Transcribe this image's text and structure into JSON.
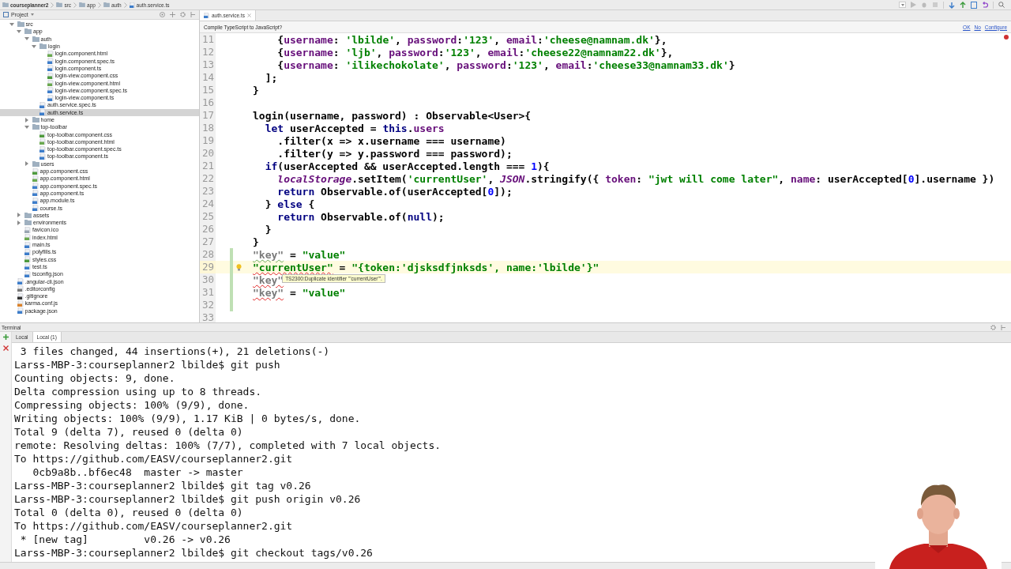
{
  "breadcrumb": [
    {
      "label": "courseplanner2",
      "kind": "project"
    },
    {
      "label": "src",
      "kind": "folder"
    },
    {
      "label": "app",
      "kind": "folder"
    },
    {
      "label": "auth",
      "kind": "folder"
    },
    {
      "label": "auth.service.ts",
      "kind": "file"
    }
  ],
  "project_panel": {
    "title": "Project",
    "tree": [
      {
        "label": "src",
        "kind": "folder",
        "expanded": true,
        "selected": false,
        "children": [
          {
            "label": "app",
            "kind": "folder",
            "expanded": true,
            "selected": false,
            "children": [
              {
                "label": "auth",
                "kind": "folder",
                "expanded": true,
                "selected": false,
                "children": [
                  {
                    "label": "login",
                    "kind": "folder",
                    "expanded": true,
                    "selected": false,
                    "children": [
                      {
                        "label": "login.component.html",
                        "kind": "html",
                        "selected": false
                      },
                      {
                        "label": "login.component.spec.ts",
                        "kind": "ts",
                        "selected": false
                      },
                      {
                        "label": "login.component.ts",
                        "kind": "ts",
                        "selected": false
                      },
                      {
                        "label": "login-view.component.css",
                        "kind": "css",
                        "selected": false
                      },
                      {
                        "label": "login-view.component.html",
                        "kind": "html",
                        "selected": false
                      },
                      {
                        "label": "login-view.component.spec.ts",
                        "kind": "ts",
                        "selected": false
                      },
                      {
                        "label": "login-view.component.ts",
                        "kind": "ts",
                        "selected": false
                      }
                    ]
                  },
                  {
                    "label": "auth.service.spec.ts",
                    "kind": "ts",
                    "selected": false
                  },
                  {
                    "label": "auth.service.ts",
                    "kind": "ts",
                    "selected": true
                  }
                ]
              },
              {
                "label": "home",
                "kind": "folder",
                "expanded": false,
                "selected": false
              },
              {
                "label": "top-toolbar",
                "kind": "folder",
                "expanded": true,
                "selected": false,
                "children": [
                  {
                    "label": "top-toolbar.component.css",
                    "kind": "css",
                    "selected": false
                  },
                  {
                    "label": "top-toolbar.component.html",
                    "kind": "html",
                    "selected": false
                  },
                  {
                    "label": "top-toolbar.component.spec.ts",
                    "kind": "ts",
                    "selected": false
                  },
                  {
                    "label": "top-toolbar.component.ts",
                    "kind": "ts",
                    "selected": false
                  }
                ]
              },
              {
                "label": "users",
                "kind": "folder",
                "expanded": false,
                "selected": false
              },
              {
                "label": "app.component.css",
                "kind": "css",
                "selected": false
              },
              {
                "label": "app.component.html",
                "kind": "html",
                "selected": false
              },
              {
                "label": "app.component.spec.ts",
                "kind": "ts",
                "selected": false
              },
              {
                "label": "app.component.ts",
                "kind": "ts",
                "selected": false
              },
              {
                "label": "app.module.ts",
                "kind": "ts",
                "selected": false
              },
              {
                "label": "course.ts",
                "kind": "ts",
                "selected": false
              }
            ]
          },
          {
            "label": "assets",
            "kind": "folder",
            "expanded": false,
            "selected": false
          },
          {
            "label": "environments",
            "kind": "folder",
            "expanded": false,
            "selected": false
          },
          {
            "label": "favicon.ico",
            "kind": "ico",
            "selected": false
          },
          {
            "label": "index.html",
            "kind": "html",
            "selected": false
          },
          {
            "label": "main.ts",
            "kind": "ts",
            "selected": false
          },
          {
            "label": "polyfills.ts",
            "kind": "ts",
            "selected": false
          },
          {
            "label": "styles.css",
            "kind": "css",
            "selected": false
          },
          {
            "label": "test.ts",
            "kind": "ts",
            "selected": false
          },
          {
            "label": "tsconfig.json",
            "kind": "json",
            "selected": false
          }
        ]
      },
      {
        "label": ".angular-cli.json",
        "kind": "json",
        "selected": false
      },
      {
        "label": ".editorconfig",
        "kind": "config",
        "selected": false
      },
      {
        "label": ".gitignore",
        "kind": "git",
        "selected": false
      },
      {
        "label": "karma.conf.js",
        "kind": "js",
        "selected": false
      },
      {
        "label": "package.json",
        "kind": "json",
        "selected": false
      }
    ]
  },
  "editor": {
    "tabs": [
      {
        "label": "auth.service.ts",
        "selected": true
      }
    ],
    "notification": {
      "text": "Compile TypeScript to JavaScript?",
      "actions": [
        "OK",
        "No",
        "Configure"
      ]
    },
    "lines": [
      {
        "number": "11",
        "current": false,
        "changed": false,
        "bulb": false,
        "tokens": [
          {
            "text": "    {",
            "kind": "plain"
          },
          {
            "text": "username",
            "kind": "property"
          },
          {
            "text": ": ",
            "kind": "plain"
          },
          {
            "text": "'lbilde'",
            "kind": "string"
          },
          {
            "text": ", ",
            "kind": "plain"
          },
          {
            "text": "password",
            "kind": "property"
          },
          {
            "text": ":",
            "kind": "plain"
          },
          {
            "text": "'123'",
            "kind": "string"
          },
          {
            "text": ", ",
            "kind": "plain"
          },
          {
            "text": "email",
            "kind": "property"
          },
          {
            "text": ":",
            "kind": "plain"
          },
          {
            "text": "'cheese@namnam.dk'",
            "kind": "string"
          },
          {
            "text": "},",
            "kind": "plain"
          }
        ]
      },
      {
        "number": "12",
        "current": false,
        "changed": false,
        "bulb": false,
        "tokens": [
          {
            "text": "    {",
            "kind": "plain"
          },
          {
            "text": "username",
            "kind": "property"
          },
          {
            "text": ": ",
            "kind": "plain"
          },
          {
            "text": "'ljb'",
            "kind": "string"
          },
          {
            "text": ", ",
            "kind": "plain"
          },
          {
            "text": "password",
            "kind": "property"
          },
          {
            "text": ":",
            "kind": "plain"
          },
          {
            "text": "'123'",
            "kind": "string"
          },
          {
            "text": ", ",
            "kind": "plain"
          },
          {
            "text": "email",
            "kind": "property"
          },
          {
            "text": ":",
            "kind": "plain"
          },
          {
            "text": "'cheese22@namnam22.dk'",
            "kind": "string"
          },
          {
            "text": "},",
            "kind": "plain"
          }
        ]
      },
      {
        "number": "13",
        "current": false,
        "changed": false,
        "bulb": false,
        "tokens": [
          {
            "text": "    {",
            "kind": "plain"
          },
          {
            "text": "username",
            "kind": "property"
          },
          {
            "text": ": ",
            "kind": "plain"
          },
          {
            "text": "'ilikechokolate'",
            "kind": "string"
          },
          {
            "text": ", ",
            "kind": "plain"
          },
          {
            "text": "password",
            "kind": "property"
          },
          {
            "text": ":",
            "kind": "plain"
          },
          {
            "text": "'123'",
            "kind": "string"
          },
          {
            "text": ", ",
            "kind": "plain"
          },
          {
            "text": "email",
            "kind": "property"
          },
          {
            "text": ":",
            "kind": "plain"
          },
          {
            "text": "'cheese33@namnam33.dk'",
            "kind": "string"
          },
          {
            "text": "}",
            "kind": "plain"
          }
        ]
      },
      {
        "number": "14",
        "current": false,
        "changed": false,
        "bulb": false,
        "tokens": [
          {
            "text": "  ];",
            "kind": "plain"
          }
        ]
      },
      {
        "number": "15",
        "current": false,
        "changed": false,
        "bulb": false,
        "tokens": [
          {
            "text": "}",
            "kind": "plain"
          }
        ]
      },
      {
        "number": "16",
        "current": false,
        "changed": false,
        "bulb": false
      },
      {
        "number": "17",
        "current": false,
        "changed": false,
        "bulb": false,
        "tokens": [
          {
            "text": "login(username, password) : Observable<User>{",
            "kind": "plain"
          }
        ]
      },
      {
        "number": "18",
        "current": false,
        "changed": false,
        "bulb": false,
        "tokens": [
          {
            "text": "  let",
            "kind": "keyword"
          },
          {
            "text": " userAccepted = ",
            "kind": "plain"
          },
          {
            "text": "this",
            "kind": "keyword"
          },
          {
            "text": ".",
            "kind": "plain"
          },
          {
            "text": "users",
            "kind": "property"
          }
        ]
      },
      {
        "number": "19",
        "current": false,
        "changed": false,
        "bulb": false,
        "tokens": [
          {
            "text": "    .filter(x => x.username === username)",
            "kind": "plain"
          }
        ]
      },
      {
        "number": "20",
        "current": false,
        "changed": false,
        "bulb": false,
        "tokens": [
          {
            "text": "    .filter(y => y.password === password);",
            "kind": "plain"
          }
        ]
      },
      {
        "number": "21",
        "current": false,
        "changed": false,
        "bulb": false,
        "tokens": [
          {
            "text": "  if",
            "kind": "keyword"
          },
          {
            "text": "(userAccepted && userAccepted.length === ",
            "kind": "plain"
          },
          {
            "text": "1",
            "kind": "number"
          },
          {
            "text": "){",
            "kind": "plain"
          }
        ]
      },
      {
        "number": "22",
        "current": false,
        "changed": false,
        "bulb": false,
        "tokens": [
          {
            "text": "    localStorage",
            "kind": "italic"
          },
          {
            "text": ".setItem(",
            "kind": "plain"
          },
          {
            "text": "'currentUser'",
            "kind": "string"
          },
          {
            "text": ", ",
            "kind": "plain"
          },
          {
            "text": "JSON",
            "kind": "italic"
          },
          {
            "text": ".stringify({ ",
            "kind": "plain"
          },
          {
            "text": "token",
            "kind": "property"
          },
          {
            "text": ": ",
            "kind": "plain"
          },
          {
            "text": "\"jwt will come later\"",
            "kind": "string"
          },
          {
            "text": ", ",
            "kind": "plain"
          },
          {
            "text": "name",
            "kind": "property"
          },
          {
            "text": ": userAccepted[",
            "kind": "plain"
          },
          {
            "text": "0",
            "kind": "number"
          },
          {
            "text": "].username })",
            "kind": "plain"
          }
        ]
      },
      {
        "number": "23",
        "current": false,
        "changed": false,
        "bulb": false,
        "tokens": [
          {
            "text": "    return",
            "kind": "keyword"
          },
          {
            "text": " Observable.of(userAccepted[",
            "kind": "plain"
          },
          {
            "text": "0",
            "kind": "number"
          },
          {
            "text": "]);",
            "kind": "plain"
          }
        ]
      },
      {
        "number": "24",
        "current": false,
        "changed": false,
        "bulb": false,
        "tokens": [
          {
            "text": "  } ",
            "kind": "plain"
          },
          {
            "text": "else",
            "kind": "keyword"
          },
          {
            "text": " {",
            "kind": "plain"
          }
        ]
      },
      {
        "number": "25",
        "current": false,
        "changed": false,
        "bulb": false,
        "tokens": [
          {
            "text": "    return",
            "kind": "keyword"
          },
          {
            "text": " Observable.of(",
            "kind": "plain"
          },
          {
            "text": "null",
            "kind": "keyword"
          },
          {
            "text": ");",
            "kind": "plain"
          }
        ]
      },
      {
        "number": "26",
        "current": false,
        "changed": false,
        "bulb": false,
        "tokens": [
          {
            "text": "  }",
            "kind": "plain"
          }
        ]
      },
      {
        "number": "27",
        "current": false,
        "changed": false,
        "bulb": false,
        "tokens": [
          {
            "text": "}",
            "kind": "plain"
          }
        ]
      },
      {
        "number": "28",
        "current": false,
        "changed": true,
        "bulb": false,
        "tokens": [
          {
            "text": "\"key\"",
            "kind": "muted",
            "warning": true
          },
          {
            "text": " = ",
            "kind": "plain"
          },
          {
            "text": "\"value\"",
            "kind": "string"
          }
        ]
      },
      {
        "number": "29",
        "current": true,
        "changed": true,
        "bulb": true,
        "tokens": [
          {
            "text": "\"currentUser\"",
            "kind": "string",
            "error": true
          },
          {
            "text": " = ",
            "kind": "plain"
          },
          {
            "text": "\"{token:'djsksdfjnksds', name:'lbilde'}\"",
            "kind": "string"
          }
        ]
      },
      {
        "number": "30",
        "current": false,
        "changed": true,
        "bulb": false,
        "tokens": [
          {
            "text": "\"key\"",
            "kind": "muted",
            "error": true
          }
        ],
        "tooltip": "TS2300:Duplicate identifier '\"currentUser\"'."
      },
      {
        "number": "31",
        "current": false,
        "changed": true,
        "bulb": false,
        "tokens": [
          {
            "text": "\"key\"",
            "kind": "muted",
            "error": true
          },
          {
            "text": " = ",
            "kind": "plain"
          },
          {
            "text": "\"value\"",
            "kind": "string"
          }
        ]
      },
      {
        "number": "32",
        "current": false,
        "changed": true,
        "bulb": false
      },
      {
        "number": "33",
        "current": false,
        "changed": false,
        "bulb": false
      }
    ]
  },
  "terminal": {
    "title": "Terminal",
    "tabs": [
      {
        "label": "Local",
        "selected": false
      },
      {
        "label": "Local (1)",
        "selected": true
      }
    ],
    "lines": [
      " 3 files changed, 44 insertions(+), 21 deletions(-)",
      "Larss-MBP-3:courseplanner2 lbilde$ git push",
      "Counting objects: 9, done.",
      "Delta compression using up to 8 threads.",
      "Compressing objects: 100% (9/9), done.",
      "Writing objects: 100% (9/9), 1.17 KiB | 0 bytes/s, done.",
      "Total 9 (delta 7), reused 0 (delta 0)",
      "remote: Resolving deltas: 100% (7/7), completed with 7 local objects.",
      "To https://github.com/EASV/courseplanner2.git",
      "   0cb9a8b..bf6ec48  master -> master",
      "Larss-MBP-3:courseplanner2 lbilde$ git tag v0.26",
      "Larss-MBP-3:courseplanner2 lbilde$ git push origin v0.26",
      "Total 0 (delta 0), reused 0 (delta 0)",
      "To https://github.com/EASV/courseplanner2.git",
      " * [new tag]         v0.26 -> v0.26",
      "Larss-MBP-3:courseplanner2 lbilde$ git checkout tags/v0.26"
    ]
  }
}
